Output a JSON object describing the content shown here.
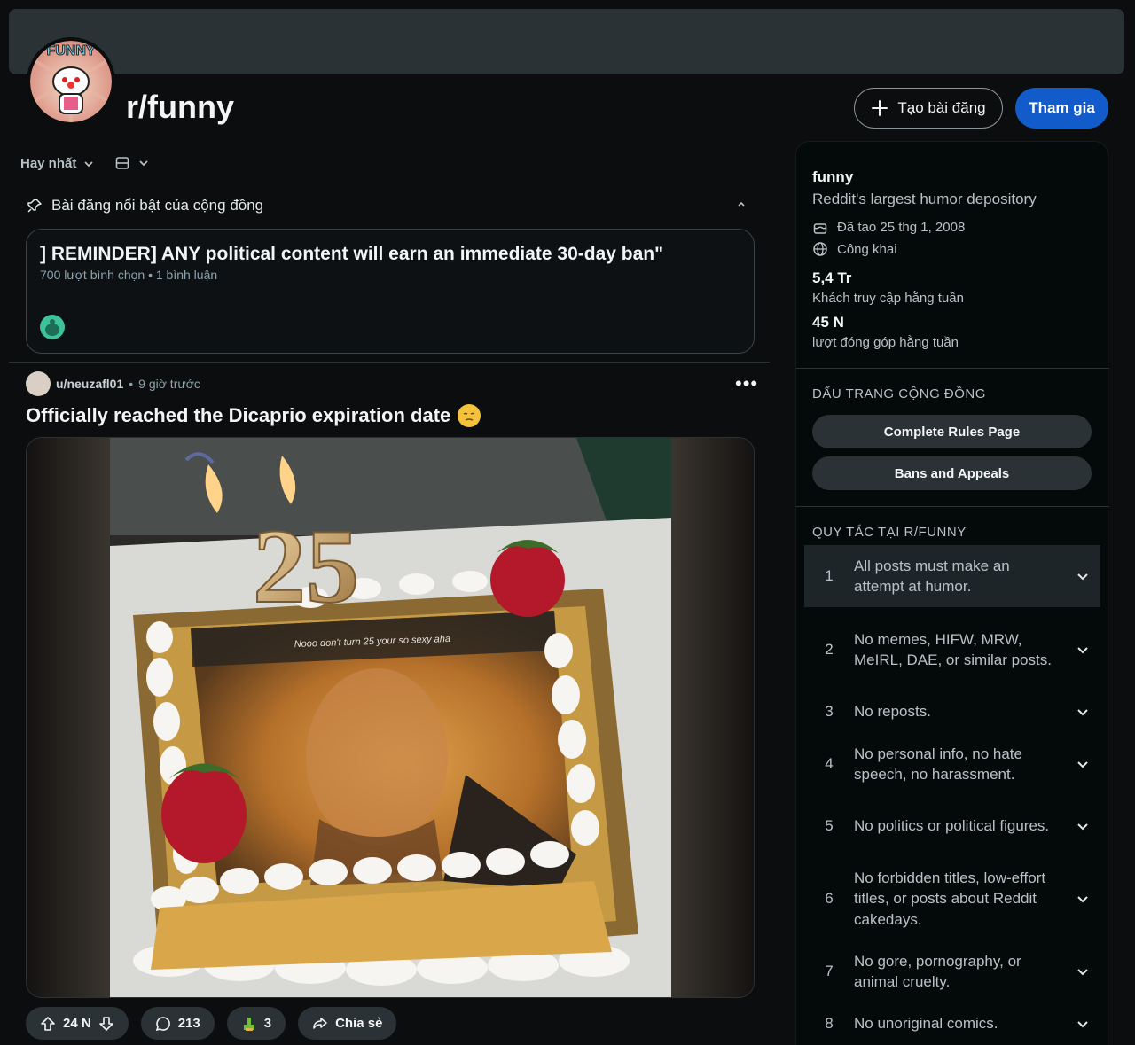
{
  "header": {
    "subreddit": "r/funny",
    "create_post_label": "Tạo bài đăng",
    "join_label": "Tham gia",
    "avatar_text": "FUNNY"
  },
  "feed": {
    "sort_label": "Hay nhất",
    "highlights_label": "Bài đăng nổi bật của cộng đồng",
    "pinned": {
      "title": "] REMINDER] ANY political content will earn an immediate 30-day ban\"",
      "meta": "700 lượt bình chọn • 1 bình luận"
    },
    "post": {
      "username": "u/neuzafl01",
      "time": "9 giờ trước",
      "title": "Officially reached the Dicaprio expiration date",
      "image_caption": "Nooo don't turn 25 your so sexy aha",
      "cake_number": "25",
      "votes": "24 N",
      "comments": "213",
      "awards": "3",
      "share": "Chia sẻ"
    }
  },
  "sidebar": {
    "name": "funny",
    "description": "Reddit's largest humor depository",
    "created": "Đã tạo 25 thg 1, 2008",
    "visibility": "Công khai",
    "stat1_value": "5,4 Tr",
    "stat1_label": "Khách truy cập hằng tuần",
    "stat2_value": "45 N",
    "stat2_label": "lượt đóng góp hằng tuần",
    "bookmarks_heading": "DẤU TRANG CỘNG ĐỒNG",
    "bookmarks": [
      "Complete Rules Page",
      "Bans and Appeals"
    ],
    "rules_heading": "QUY TẮC TẠI R/FUNNY",
    "rules": [
      {
        "num": "1",
        "text": "All posts must make an attempt at humor."
      },
      {
        "num": "2",
        "text": "No memes, HIFW, MRW, MeIRL, DAE, or similar posts."
      },
      {
        "num": "3",
        "text": "No reposts."
      },
      {
        "num": "4",
        "text": "No personal info, no hate speech, no harassment."
      },
      {
        "num": "5",
        "text": "No politics or political figures."
      },
      {
        "num": "6",
        "text": "No forbidden titles, low-effort titles, or posts about Reddit cakedays."
      },
      {
        "num": "7",
        "text": "No gore, pornography, or animal cruelty."
      },
      {
        "num": "8",
        "text": "No unoriginal comics."
      }
    ]
  },
  "colors": {
    "background": "#0b0d0e",
    "join_button": "#115bca",
    "pill": "#2a3236"
  }
}
